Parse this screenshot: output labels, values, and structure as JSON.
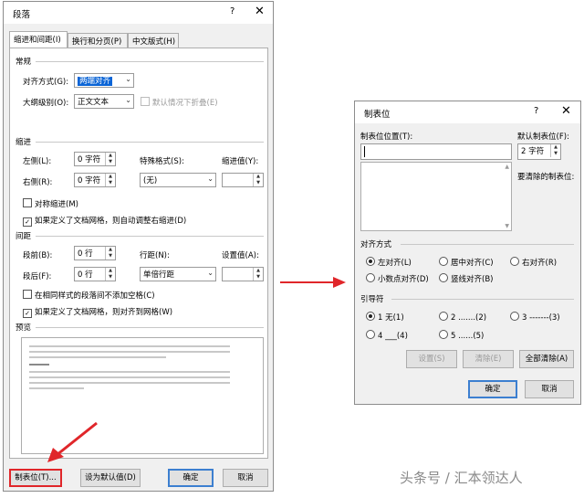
{
  "left_dialog": {
    "title": "段落",
    "help": "?",
    "close": "✕",
    "tabs": [
      "缩进和间距(I)",
      "换行和分页(P)",
      "中文版式(H)"
    ],
    "general": {
      "section": "常规",
      "align_label": "对齐方式(G):",
      "align_value": "两端对齐",
      "outline_label": "大纲级别(O):",
      "outline_value": "正文文本",
      "collapse_label": "默认情况下折叠(E)"
    },
    "indent": {
      "section": "缩进",
      "left_label": "左侧(L):",
      "left_value": "0 字符",
      "right_label": "右侧(R):",
      "right_value": "0 字符",
      "special_label": "特殊格式(S):",
      "special_value": "(无)",
      "indent_by_label": "缩进值(Y):",
      "mirror_label": "对称缩进(M)",
      "auto_adjust_label": "如果定义了文档网格，则自动调整右缩进(D)"
    },
    "spacing": {
      "section": "间距",
      "before_label": "段前(B):",
      "before_value": "0 行",
      "after_label": "段后(F):",
      "after_value": "0 行",
      "line_label": "行距(N):",
      "line_value": "单倍行距",
      "at_label": "设置值(A):",
      "no_space_label": "在相同样式的段落间不添加空格(C)",
      "snap_grid_label": "如果定义了文档网格，则对齐到网格(W)"
    },
    "preview": {
      "section": "预览"
    },
    "buttons": {
      "tabs": "制表位(T)...",
      "default": "设为默认值(D)",
      "ok": "确定",
      "cancel": "取消"
    }
  },
  "right_dialog": {
    "title": "制表位",
    "help": "?",
    "close": "✕",
    "tab_stop_label": "制表位位置(T):",
    "tab_stop_value": "",
    "default_label": "默认制表位(F):",
    "default_value": "2 字符",
    "clear_label": "要清除的制表位:",
    "alignment": {
      "section": "对齐方式",
      "options": [
        "左对齐(L)",
        "居中对齐(C)",
        "右对齐(R)",
        "小数点对齐(D)",
        "竖线对齐(B)"
      ],
      "selected": "左对齐(L)"
    },
    "leader": {
      "section": "引导符",
      "options": [
        "1 无(1)",
        "2 .......(2)",
        "3 -------(3)",
        "4 ___(4)",
        "5 ......(5)"
      ],
      "selected": "1 无(1)"
    },
    "buttons": {
      "set": "设置(S)",
      "clear": "清除(E)",
      "clear_all": "全部清除(A)",
      "ok": "确定",
      "cancel": "取消"
    }
  },
  "arrow_right": "→",
  "watermark": "头条号 / 汇本领达人",
  "colors": {
    "highlight_red": "#e0262a",
    "selection_blue": "#0a64d6"
  }
}
